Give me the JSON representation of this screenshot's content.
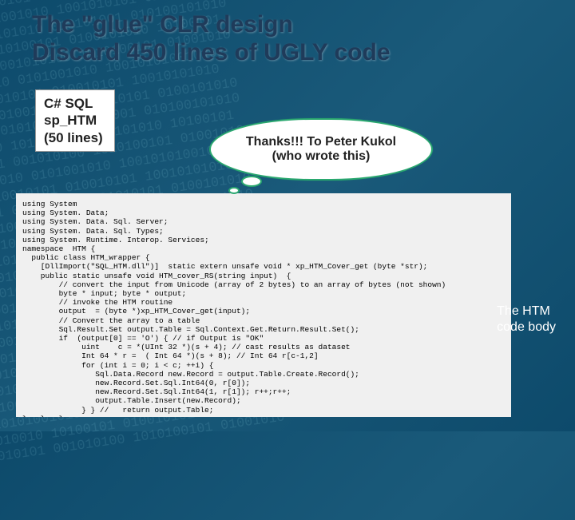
{
  "title": {
    "line1": "The \"glue\" CLR design",
    "line2": "Discard 450 lines of UGLY code"
  },
  "box_csharp": {
    "line1": "C# SQL",
    "line2": "sp_HTM",
    "line3": "(50 lines)"
  },
  "bubble_text": "Thanks!!! To Peter Kukol (who wrote this)",
  "htm_label": {
    "line1": "The HTM",
    "line2": "code body"
  },
  "code": "using System\nusing System. Data;\nusing System. Data. Sql. Server;\nusing System. Data. Sql. Types;\nusing System. Runtime. Interop. Services;\nnamespace  HTM {\n  public class HTM_wrapper {\n    [DllImport(\"SQL_HTM.dll\")]  static extern unsafe void * xp_HTM_Cover_get (byte *str);\n    public static unsafe void HTM_cover_RS(string input)  {\n        // convert the input from Unicode (array of 2 bytes) to an array of bytes (not shown)\n        byte * input; byte * output;\n        // invoke the HTM routine\n        output  = (byte *)xp_HTM_Cover_get(input);\n        // Convert the array to a table\n        Sql.Result.Set output.Table = Sql.Context.Get.Return.Result.Set();\n        if  (output[0] == 'O') { // if Output is \"OK\"\n             uint    c = *(UInt 32 *)(s + 4); // cast results as dataset\n             Int 64 * r =  ( Int 64 *)(s + 8); // Int 64 r[c-1,2]\n             for (int i = 0; i < c; ++i) {\n                Sql.Data.Record new.Record = output.Table.Create.Record();\n                new.Record.Set.Sql.Int64(0, r[0]);\n                new.Record.Set.Sql.Int64(1, r[1]); r++;r++;\n                output.Table.Insert(new.Record);\n             } } //   return output.Table;\n}   }   }",
  "binary_deco": "010101010010101 010010101 10010101010\n10101001 01001010 1001010101 0100101010\n0101010100101010 010101001 010100101010\n101010010 10100101 0100101010 10100101\n010010101 001010100 1010100101 01001010\n10100101010 0101001010 100101010010101\n010101010010101 010010101 10010101010\n10101001 01001010 1001010101 0100101010\n0101010100101010 010101001 010100101010\n101010010 10100101 0100101010 10100101\n010010101 001010100 1010100101 01001010\n10100101010 0101001010 100101010010101\n010101010010101 010010101 10010101010\n10101001 01001010 1001010101 0100101010\n0101010100101010 010101001 010100101010\n101010010 10100101 0100101010 10100101\n010010101 001010100 1010100101 01001010\n10100101010 0101001010 100101010010101\n010101010010101 010010101 10010101010\n10101001 01001010 1001010101 0100101010\n0101010100101010 010101001 010100101010\n101010010 10100101 0100101010 10100101\n010010101 001010100 1010100101 01001010\n10100101010 0101001010 100101010010101\n010101010010101 010010101 10010101010\n10101001 01001010 1001010101 0100101010\n0101010100101010 010101001 010100101010\n101010010 10100101 0100101010 10100101\n010010101 001010100 1010100101 01001010"
}
